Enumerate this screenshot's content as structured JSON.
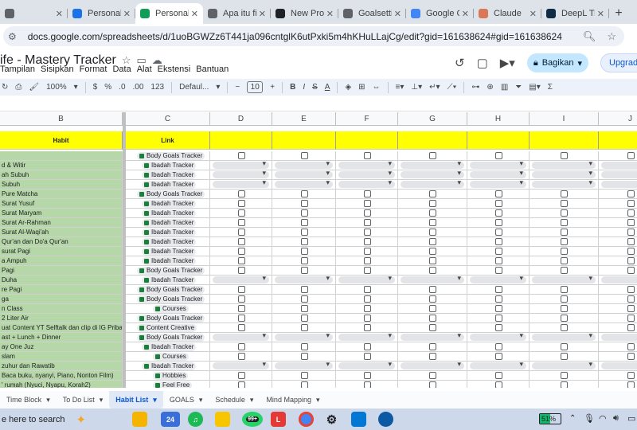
{
  "browser": {
    "tabs": [
      {
        "label": "",
        "fav_color": "#5f6368",
        "active": false
      },
      {
        "label": "Personal",
        "fav_color": "#1a73e8",
        "active": false
      },
      {
        "label": "Personal",
        "fav_color": "#0f9d58",
        "active": true
      },
      {
        "label": "Apa itu fi",
        "fav_color": "#5f6368",
        "active": false
      },
      {
        "label": "New Proje",
        "fav_color": "#202124",
        "active": false
      },
      {
        "label": "Goalsettin",
        "fav_color": "#5f6368",
        "active": false
      },
      {
        "label": "Google G",
        "fav_color": "#4285f4",
        "active": false
      },
      {
        "label": "Claude",
        "fav_color": "#d97757",
        "active": false
      },
      {
        "label": "DeepL Tra",
        "fav_color": "#0f2b46",
        "active": false
      }
    ],
    "new_tab": "+",
    "url": "docs.google.com/spreadsheets/d/1uoBGWZz6T441ja096cntglK6utPxki5m4hKHuLLajCg/edit?gid=161638624#gid=161638624"
  },
  "doc": {
    "title": "ife - Mastery Tracker",
    "menus": [
      "Tampilan",
      "Sisipkan",
      "Format",
      "Data",
      "Alat",
      "Ekstensi",
      "Bantuan"
    ],
    "share_label": "Bagikan",
    "upgrade_label": "Upgrad"
  },
  "toolbar": {
    "zoom": "100%",
    "currency": "$",
    "percent": "%",
    "dec_less": ".0",
    "dec_more": ".00",
    "number_format": "123",
    "font": "Defaul...",
    "font_size": "10",
    "bold": "B",
    "italic": "I",
    "strike": "S",
    "text_color": "A",
    "sigma": "Σ"
  },
  "grid": {
    "columns": [
      "B",
      "C",
      "D",
      "E",
      "F",
      "G",
      "H",
      "I",
      "J"
    ],
    "headers": {
      "habit": "Habit",
      "link": "Link"
    },
    "rows": [
      {
        "habit": "",
        "link": "Body Goals Tracker",
        "type": "check"
      },
      {
        "habit": "d & Witir",
        "link": "Ibadah Tracker",
        "type": "dropdown"
      },
      {
        "habit": "ah Subuh",
        "link": "Ibadah Tracker",
        "type": "dropdown"
      },
      {
        "habit": "Subuh",
        "link": "Ibadah Tracker",
        "type": "dropdown"
      },
      {
        "habit": " Pure Matcha",
        "link": "Body Goals Tracker",
        "type": "check"
      },
      {
        "habit": "Surat Yusuf",
        "link": "Ibadah Tracker",
        "type": "check"
      },
      {
        "habit": "Surat  Maryam",
        "link": "Ibadah Tracker",
        "type": "check"
      },
      {
        "habit": "Surat Ar-Rahman",
        "link": "Ibadah Tracker",
        "type": "check"
      },
      {
        "habit": "Surat Al-Waqi'ah",
        "link": "Ibadah Tracker",
        "type": "check"
      },
      {
        "habit": "Qur'an dan Do'a Qur'an",
        "link": "Ibadah Tracker",
        "type": "check"
      },
      {
        "habit": "surat Pagi",
        "link": "Ibadah Tracker",
        "type": "check"
      },
      {
        "habit": "a Ampuh",
        "link": "Ibadah Tracker",
        "type": "check"
      },
      {
        "habit": "Pagi",
        "link": "Body Goals Tracker",
        "type": "check"
      },
      {
        "habit": "Duha",
        "link": "Ibadah Tracker",
        "type": "dropdown"
      },
      {
        "habit": "re Pagi",
        "link": "Body Goals Tracker",
        "type": "check"
      },
      {
        "habit": "ga",
        "link": "Body Goals Tracker",
        "type": "check"
      },
      {
        "habit": "n Class",
        "link": "Courses",
        "type": "check"
      },
      {
        "habit": " 2 Liter Air",
        "link": "Body Goals Tracker",
        "type": "check"
      },
      {
        "habit": "uat Content YT Selftalk dan clip di IG Pribadi",
        "link": "Content Creative",
        "type": "check"
      },
      {
        "habit": "ast + Lunch + Dinner",
        "link": "Body Goals Tracker",
        "type": "dropdown"
      },
      {
        "habit": "ay One Juz",
        "link": "Ibadah Tracker",
        "type": "check"
      },
      {
        "habit": "slam",
        "link": "Courses",
        "type": "check"
      },
      {
        "habit": "zuhur dan Rawatib",
        "link": "Ibadah Tracker",
        "type": "dropdown"
      },
      {
        "habit": "Baca buku, nyanyi, Piano, Nonton Film)",
        "link": "Hobbies",
        "type": "check"
      },
      {
        "habit": "' rumah (Nyuci, Nyapu, Korah2)",
        "link": "Feel Free",
        "type": "check"
      }
    ]
  },
  "sheet_tabs": [
    {
      "label": "Time Block",
      "active": false
    },
    {
      "label": "To Do List",
      "active": false
    },
    {
      "label": "Habit List",
      "active": true
    },
    {
      "label": "GOALS",
      "active": false
    },
    {
      "label": "Schedule",
      "active": false
    },
    {
      "label": "Mind Mapping",
      "active": false
    }
  ],
  "taskbar": {
    "search_label": "e here to search",
    "weather_badge": "24",
    "mail_badge": "99+",
    "battery_percent": "51%",
    "battery_level": 0.51
  }
}
